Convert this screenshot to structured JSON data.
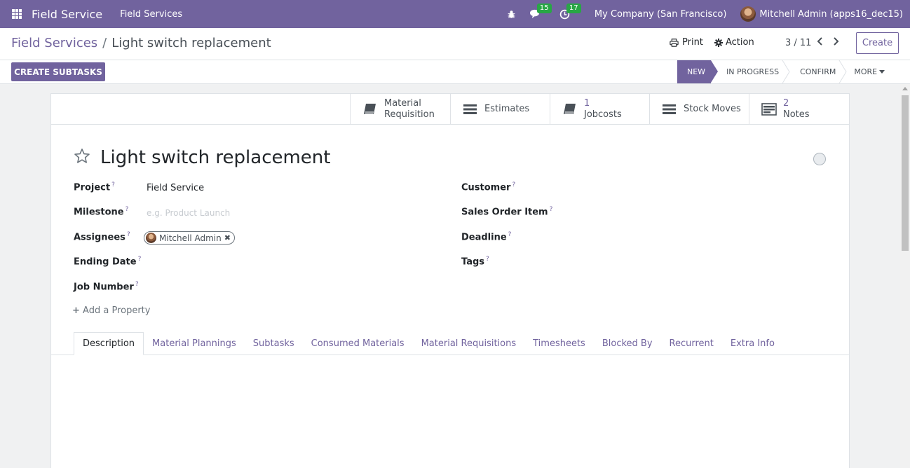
{
  "navbar": {
    "brand": "Field Service",
    "menu": "Field Services",
    "chat_count": "15",
    "activity_count": "17",
    "company": "My Company (San Francisco)",
    "user": "Mitchell Admin (apps16_dec15)"
  },
  "control": {
    "breadcrumb_parent": "Field Services",
    "breadcrumb_sep": "/",
    "breadcrumb_current": "Light switch replacement",
    "print": "Print",
    "action": "Action",
    "pager": "3 / 11",
    "create": "Create"
  },
  "statusbar": {
    "create_subtasks": "CREATE SUBTASKS",
    "stages": [
      "NEW",
      "IN PROGRESS",
      "CONFIRM"
    ],
    "active_stage": "NEW",
    "more": "MORE"
  },
  "smart_buttons": [
    {
      "icon": "book-icon",
      "line1": "Material",
      "line2": "Requisition"
    },
    {
      "icon": "list-icon",
      "line1": "Estimates",
      "line2": ""
    },
    {
      "icon": "book-icon",
      "line1": "1",
      "line2": "Jobcosts"
    },
    {
      "icon": "list-icon",
      "line1": "Stock Moves",
      "line2": ""
    },
    {
      "icon": "notes-icon",
      "line1": "2",
      "line2": "Notes"
    }
  ],
  "record": {
    "title": "Light switch replacement"
  },
  "fields": {
    "project_label": "Project",
    "project_value": "Field Service",
    "milestone_label": "Milestone",
    "milestone_placeholder": "e.g. Product Launch",
    "assignees_label": "Assignees",
    "assignee": "Mitchell Admin",
    "ending_date_label": "Ending Date",
    "job_number_label": "Job Number",
    "customer_label": "Customer",
    "sales_order_item_label": "Sales Order Item",
    "deadline_label": "Deadline",
    "tags_label": "Tags",
    "help_mark": "?",
    "add_property": "Add a Property"
  },
  "tabs": [
    "Description",
    "Material Plannings",
    "Subtasks",
    "Consumed Materials",
    "Material Requisitions",
    "Timesheets",
    "Blocked By",
    "Recurrent",
    "Extra Info"
  ],
  "active_tab": "Description",
  "colors": {
    "brand": "#71639e",
    "badge": "#28a745"
  }
}
